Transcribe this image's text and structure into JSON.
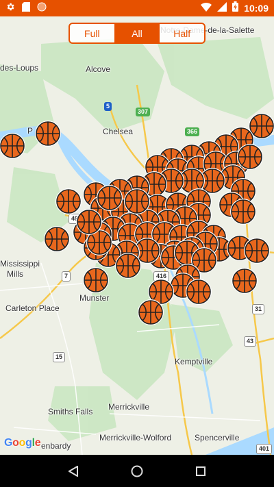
{
  "status_bar": {
    "time": "10:09",
    "left_icons": [
      "gear-icon",
      "sd-card-icon",
      "orange-circle-icon"
    ],
    "right_icons": [
      "wifi-icon",
      "signal-icon",
      "battery-icon"
    ]
  },
  "filter_toggle": {
    "options": [
      "Full",
      "All",
      "Half"
    ],
    "selected": "All"
  },
  "map": {
    "labels": {
      "notre_dame": "Notre-Dame-de-la-Salette",
      "des_loups": "des-Loups",
      "alcove": "Alcove",
      "chelsea": "Chelsea",
      "mississippi": "Mississippi",
      "mills": "Mills",
      "carleton_place": "Carleton Place",
      "munster": "Munster",
      "kemptville": "Kemptville",
      "merrickville": "Merrickville",
      "smiths_falls": "Smiths Falls",
      "merrickville_wolford": "Merrickville-Wolford",
      "spencerville": "Spencerville",
      "enbardy": "enbardy",
      "p_label": "P"
    },
    "route_shields": {
      "r5": "5",
      "r307": "307",
      "r366": "366",
      "r49": "49",
      "r7": "7",
      "r416": "416",
      "r31": "31",
      "r43": "43",
      "r15": "15",
      "r401": "401"
    },
    "court_marker_icon": "basketball-icon",
    "attribution": "Google"
  },
  "nav_bar": {
    "icons": [
      "back-icon",
      "home-icon",
      "recents-icon"
    ]
  },
  "colors": {
    "accent": "#e65100",
    "ball": "#e8671d",
    "water": "#aadaff",
    "park": "#c8e6c0"
  }
}
